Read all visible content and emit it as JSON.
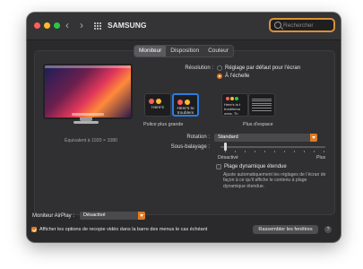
{
  "window": {
    "title": "SAMSUNG",
    "nav_back": "‹",
    "nav_forward": "›",
    "search_placeholder": "Rechercher"
  },
  "tabs": [
    "Moniteur",
    "Disposition",
    "Couleur"
  ],
  "display": {
    "equivalent": "Équivalent à 1920 × 1080"
  },
  "resolution": {
    "label": "Résolution :",
    "options": [
      "Réglage par défaut pour l’écran",
      "À l’échelle"
    ],
    "selected_index": 1,
    "thumbnails": [
      {
        "text": "Here’s"
      },
      {
        "text": "Here’s to troublem"
      },
      {
        "text": "Here’s to t troublema ones. Th"
      },
      {
        "text": ""
      }
    ],
    "selected_thumbnail": 1,
    "range_left": "Police plus grande",
    "range_right": "Plus d’espace"
  },
  "rotation": {
    "label": "Rotation :",
    "value": "Standard"
  },
  "underscan": {
    "label": "Sous-balayage :",
    "min_label": "Désactivé",
    "max_label": "Plus",
    "level": 0
  },
  "hdr": {
    "label": "Plage dynamique étendue",
    "checked": false,
    "description": "Ajuste automatiquement les réglages de l’écran de façon à ce qu’il affiche le contenu à plage dynamique étendue."
  },
  "airplay": {
    "label": "Moniteur AirPlay :",
    "value": "Désactivé"
  },
  "mirroring": {
    "label": "Afficher les options de recopie vidéo dans la barre des menus le cas échéant",
    "checked": true
  },
  "buttons": {
    "gather": "Rassembler les fenêtres",
    "help": "?"
  },
  "colors": {
    "accent": "#e07a22",
    "close": "#ff5f57",
    "minimize": "#febc2e",
    "zoom": "#28c840",
    "selection": "#2b7de0"
  }
}
